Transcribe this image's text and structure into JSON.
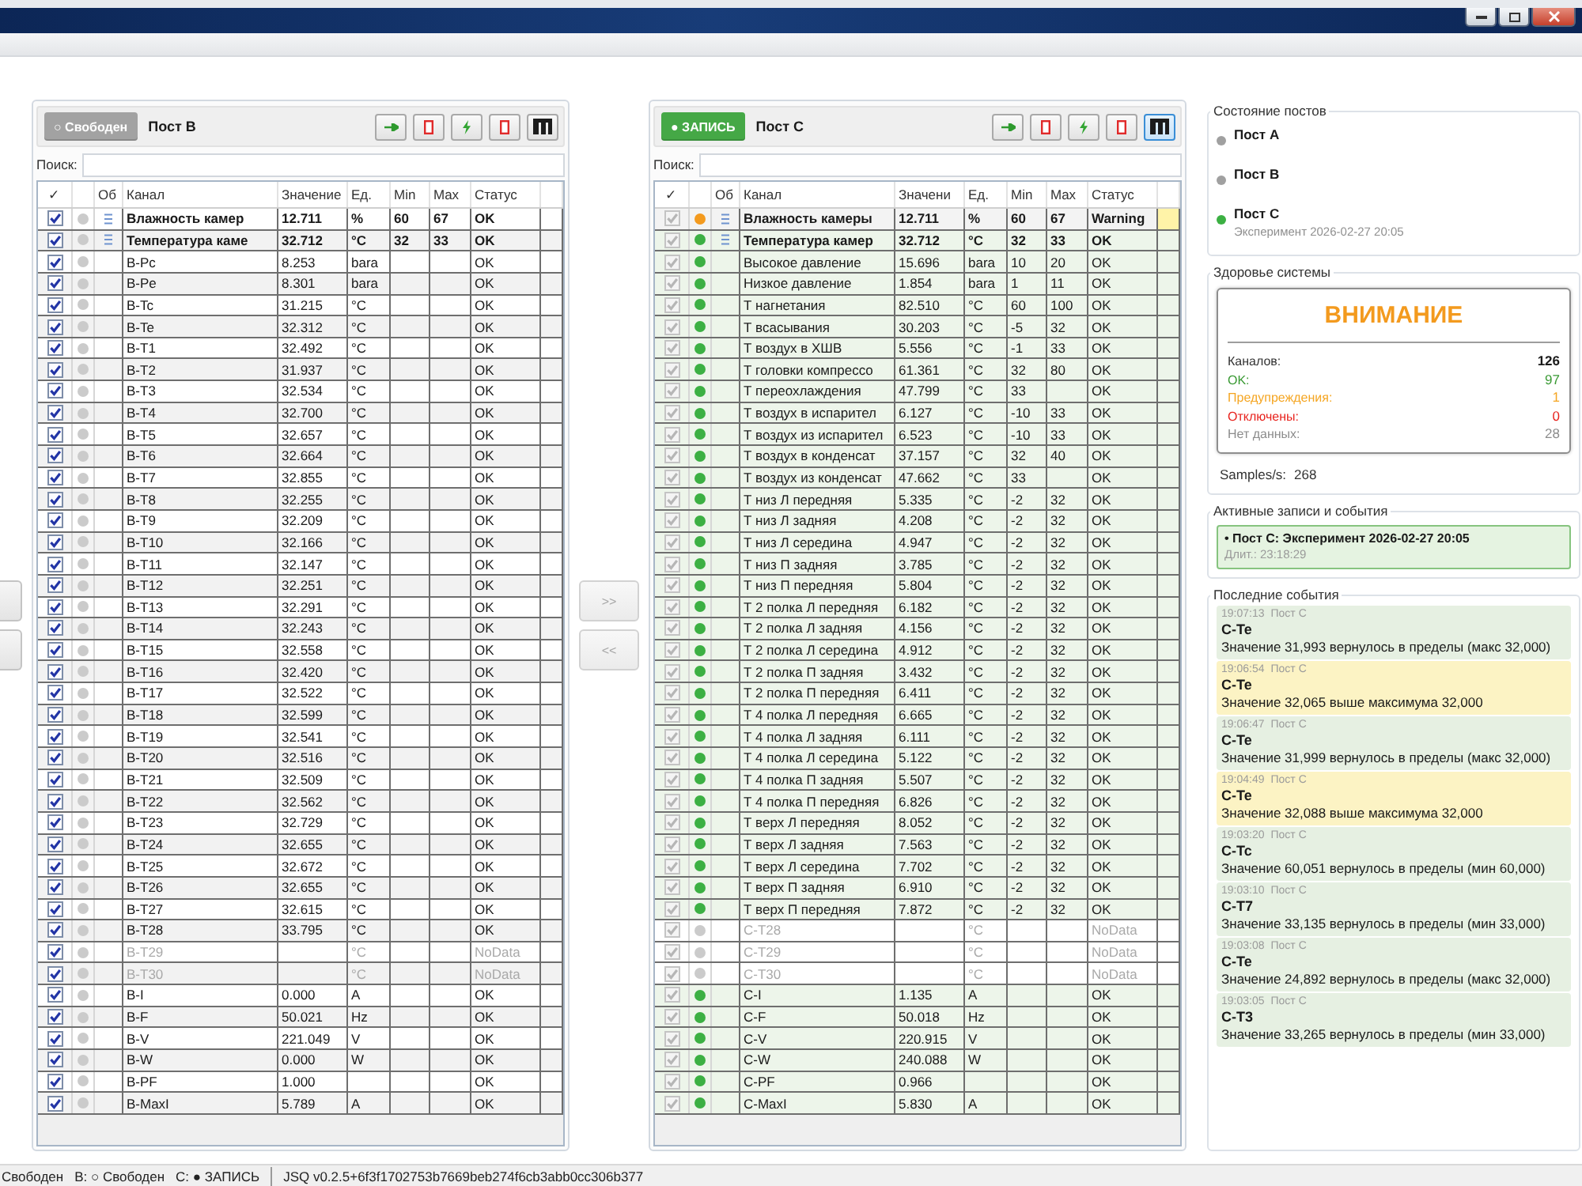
{
  "posts": [
    {
      "title": "Пост B",
      "status": {
        "kind": "free",
        "label": "○ Свободен"
      },
      "tools": [
        {
          "kind": "arrow",
          "selected": false
        },
        {
          "kind": "stop",
          "selected": false
        },
        {
          "kind": "bolt",
          "selected": false
        },
        {
          "kind": "stop",
          "selected": false
        },
        {
          "kind": "columns",
          "selected": false
        }
      ],
      "search": {
        "label": "Поиск:"
      },
      "header": {
        "check": "✓",
        "group": "Об",
        "channel": "Канал",
        "value": "Значение",
        "unit": "Ед.",
        "min": "Min",
        "max": "Max",
        "status": "Статус"
      },
      "rows": [
        {
          "kind": "group",
          "checked": true,
          "warning": false,
          "no_data": false,
          "channel": "Влажность камер",
          "value": "12.711",
          "unit": "%",
          "min": "60",
          "max": "67",
          "status": "OK"
        },
        {
          "kind": "group",
          "checked": true,
          "warning": false,
          "no_data": false,
          "channel": "Температура каме",
          "value": "32.712",
          "unit": "°C",
          "min": "32",
          "max": "33",
          "status": "OK"
        },
        {
          "kind": "sensor",
          "checked": true,
          "warning": false,
          "no_data": false,
          "channel": "B-Pc",
          "value": "8.253",
          "unit": "bara",
          "status": "OK"
        },
        {
          "kind": "sensor",
          "checked": true,
          "warning": false,
          "no_data": false,
          "channel": "B-Pe",
          "value": "8.301",
          "unit": "bara",
          "status": "OK"
        },
        {
          "kind": "sensor",
          "checked": true,
          "warning": false,
          "no_data": false,
          "channel": "B-Tc",
          "value": "31.215",
          "unit": "°C",
          "status": "OK"
        },
        {
          "kind": "sensor",
          "checked": true,
          "warning": false,
          "no_data": false,
          "channel": "B-Te",
          "value": "32.312",
          "unit": "°C",
          "status": "OK"
        },
        {
          "kind": "sensor",
          "checked": true,
          "warning": false,
          "no_data": false,
          "channel": "B-T1",
          "value": "32.492",
          "unit": "°C",
          "status": "OK"
        },
        {
          "kind": "sensor",
          "checked": true,
          "warning": false,
          "no_data": false,
          "channel": "B-T2",
          "value": "31.937",
          "unit": "°C",
          "status": "OK"
        },
        {
          "kind": "sensor",
          "checked": true,
          "warning": false,
          "no_data": false,
          "channel": "B-T3",
          "value": "32.534",
          "unit": "°C",
          "status": "OK"
        },
        {
          "kind": "sensor",
          "checked": true,
          "warning": false,
          "no_data": false,
          "channel": "B-T4",
          "value": "32.700",
          "unit": "°C",
          "status": "OK"
        },
        {
          "kind": "sensor",
          "checked": true,
          "warning": false,
          "no_data": false,
          "channel": "B-T5",
          "value": "32.657",
          "unit": "°C",
          "status": "OK"
        },
        {
          "kind": "sensor",
          "checked": true,
          "warning": false,
          "no_data": false,
          "channel": "B-T6",
          "value": "32.664",
          "unit": "°C",
          "status": "OK"
        },
        {
          "kind": "sensor",
          "checked": true,
          "warning": false,
          "no_data": false,
          "channel": "B-T7",
          "value": "32.855",
          "unit": "°C",
          "status": "OK"
        },
        {
          "kind": "sensor",
          "checked": true,
          "warning": false,
          "no_data": false,
          "channel": "B-T8",
          "value": "32.255",
          "unit": "°C",
          "status": "OK"
        },
        {
          "kind": "sensor",
          "checked": true,
          "warning": false,
          "no_data": false,
          "channel": "B-T9",
          "value": "32.209",
          "unit": "°C",
          "status": "OK"
        },
        {
          "kind": "sensor",
          "checked": true,
          "warning": false,
          "no_data": false,
          "channel": "B-T10",
          "value": "32.166",
          "unit": "°C",
          "status": "OK"
        },
        {
          "kind": "sensor",
          "checked": true,
          "warning": false,
          "no_data": false,
          "channel": "B-T11",
          "value": "32.147",
          "unit": "°C",
          "status": "OK"
        },
        {
          "kind": "sensor",
          "checked": true,
          "warning": false,
          "no_data": false,
          "channel": "B-T12",
          "value": "32.251",
          "unit": "°C",
          "status": "OK"
        },
        {
          "kind": "sensor",
          "checked": true,
          "warning": false,
          "no_data": false,
          "channel": "B-T13",
          "value": "32.291",
          "unit": "°C",
          "status": "OK"
        },
        {
          "kind": "sensor",
          "checked": true,
          "warning": false,
          "no_data": false,
          "channel": "B-T14",
          "value": "32.243",
          "unit": "°C",
          "status": "OK"
        },
        {
          "kind": "sensor",
          "checked": true,
          "warning": false,
          "no_data": false,
          "channel": "B-T15",
          "value": "32.558",
          "unit": "°C",
          "status": "OK"
        },
        {
          "kind": "sensor",
          "checked": true,
          "warning": false,
          "no_data": false,
          "channel": "B-T16",
          "value": "32.420",
          "unit": "°C",
          "status": "OK"
        },
        {
          "kind": "sensor",
          "checked": true,
          "warning": false,
          "no_data": false,
          "channel": "B-T17",
          "value": "32.522",
          "unit": "°C",
          "status": "OK"
        },
        {
          "kind": "sensor",
          "checked": true,
          "warning": false,
          "no_data": false,
          "channel": "B-T18",
          "value": "32.599",
          "unit": "°C",
          "status": "OK"
        },
        {
          "kind": "sensor",
          "checked": true,
          "warning": false,
          "no_data": false,
          "channel": "B-T19",
          "value": "32.541",
          "unit": "°C",
          "status": "OK"
        },
        {
          "kind": "sensor",
          "checked": true,
          "warning": false,
          "no_data": false,
          "channel": "B-T20",
          "value": "32.516",
          "unit": "°C",
          "status": "OK"
        },
        {
          "kind": "sensor",
          "checked": true,
          "warning": false,
          "no_data": false,
          "channel": "B-T21",
          "value": "32.509",
          "unit": "°C",
          "status": "OK"
        },
        {
          "kind": "sensor",
          "checked": true,
          "warning": false,
          "no_data": false,
          "channel": "B-T22",
          "value": "32.562",
          "unit": "°C",
          "status": "OK"
        },
        {
          "kind": "sensor",
          "checked": true,
          "warning": false,
          "no_data": false,
          "channel": "B-T23",
          "value": "32.729",
          "unit": "°C",
          "status": "OK"
        },
        {
          "kind": "sensor",
          "checked": true,
          "warning": false,
          "no_data": false,
          "channel": "B-T24",
          "value": "32.655",
          "unit": "°C",
          "status": "OK"
        },
        {
          "kind": "sensor",
          "checked": true,
          "warning": false,
          "no_data": false,
          "channel": "B-T25",
          "value": "32.672",
          "unit": "°C",
          "status": "OK"
        },
        {
          "kind": "sensor",
          "checked": true,
          "warning": false,
          "no_data": false,
          "channel": "B-T26",
          "value": "32.655",
          "unit": "°C",
          "status": "OK"
        },
        {
          "kind": "sensor",
          "checked": true,
          "warning": false,
          "no_data": false,
          "channel": "B-T27",
          "value": "32.615",
          "unit": "°C",
          "status": "OK"
        },
        {
          "kind": "sensor",
          "checked": true,
          "warning": false,
          "no_data": false,
          "channel": "B-T28",
          "value": "33.795",
          "unit": "°C",
          "status": "OK"
        },
        {
          "kind": "sensor",
          "checked": true,
          "warning": false,
          "no_data": true,
          "channel": "B-T29",
          "unit": "°C",
          "status": "NoData"
        },
        {
          "kind": "sensor",
          "checked": true,
          "warning": false,
          "no_data": true,
          "channel": "B-T30",
          "unit": "°C",
          "status": "NoData"
        },
        {
          "kind": "sensor",
          "checked": true,
          "warning": false,
          "no_data": false,
          "channel": "B-I",
          "value": "0.000",
          "unit": "A",
          "status": "OK"
        },
        {
          "kind": "sensor",
          "checked": true,
          "warning": false,
          "no_data": false,
          "channel": "B-F",
          "value": "50.021",
          "unit": "Hz",
          "status": "OK"
        },
        {
          "kind": "sensor",
          "checked": true,
          "warning": false,
          "no_data": false,
          "channel": "B-V",
          "value": "221.049",
          "unit": "V",
          "status": "OK"
        },
        {
          "kind": "sensor",
          "checked": true,
          "warning": false,
          "no_data": false,
          "channel": "B-W",
          "value": "0.000",
          "unit": "W",
          "status": "OK"
        },
        {
          "kind": "sensor",
          "checked": true,
          "warning": false,
          "no_data": false,
          "channel": "B-PF",
          "value": "1.000",
          "status": "OK"
        },
        {
          "kind": "sensor",
          "checked": true,
          "warning": false,
          "no_data": false,
          "channel": "B-MaxI",
          "value": "5.789",
          "unit": "A",
          "status": "OK"
        }
      ]
    },
    {
      "title": "Пост C",
      "status": {
        "kind": "recording",
        "label": "● ЗАПИСЬ"
      },
      "tools": [
        {
          "kind": "arrow",
          "selected": false
        },
        {
          "kind": "stop",
          "selected": false
        },
        {
          "kind": "bolt",
          "selected": false
        },
        {
          "kind": "stop",
          "selected": false
        },
        {
          "kind": "columns",
          "selected": true
        }
      ],
      "search": {
        "label": "Поиск:"
      },
      "header": {
        "check": "✓",
        "group": "Об",
        "channel": "Канал",
        "value": "Значени",
        "unit": "Ед.",
        "min": "Min",
        "max": "Max",
        "status": "Статус"
      },
      "rows": [
        {
          "kind": "group",
          "checked": true,
          "warning": true,
          "no_data": false,
          "channel": "Влажность камеры",
          "value": "12.711",
          "unit": "%",
          "min": "60",
          "max": "67",
          "status": "Warning"
        },
        {
          "kind": "group",
          "checked": true,
          "warning": false,
          "no_data": false,
          "channel": "Температура камер",
          "value": "32.712",
          "unit": "°C",
          "min": "32",
          "max": "33",
          "status": "OK"
        },
        {
          "kind": "sensor",
          "checked": true,
          "warning": false,
          "no_data": false,
          "channel": "Высокое давление",
          "value": "15.696",
          "unit": "bara",
          "min": "10",
          "max": "20",
          "status": "OK"
        },
        {
          "kind": "sensor",
          "checked": true,
          "warning": false,
          "no_data": false,
          "channel": "Низкое давление",
          "value": "1.854",
          "unit": "bara",
          "min": "1",
          "max": "11",
          "status": "OK"
        },
        {
          "kind": "sensor",
          "checked": true,
          "warning": false,
          "no_data": false,
          "channel": "Т нагнетания",
          "value": "82.510",
          "unit": "°C",
          "min": "60",
          "max": "100",
          "status": "OK"
        },
        {
          "kind": "sensor",
          "checked": true,
          "warning": false,
          "no_data": false,
          "channel": "Т всасывания",
          "value": "30.203",
          "unit": "°C",
          "min": "-5",
          "max": "32",
          "status": "OK"
        },
        {
          "kind": "sensor",
          "checked": true,
          "warning": false,
          "no_data": false,
          "channel": "Т воздух в ХШВ",
          "value": "5.556",
          "unit": "°C",
          "min": "-1",
          "max": "33",
          "status": "OK"
        },
        {
          "kind": "sensor",
          "checked": true,
          "warning": false,
          "no_data": false,
          "channel": "Т головки компрессо",
          "value": "61.361",
          "unit": "°C",
          "min": "32",
          "max": "80",
          "status": "OK"
        },
        {
          "kind": "sensor",
          "checked": true,
          "warning": false,
          "no_data": false,
          "channel": "Т переохлаждения",
          "value": "47.799",
          "unit": "°C",
          "min": "33",
          "status": "OK"
        },
        {
          "kind": "sensor",
          "checked": true,
          "warning": false,
          "no_data": false,
          "channel": "Т воздух в испарител",
          "value": "6.127",
          "unit": "°C",
          "min": "-10",
          "max": "33",
          "status": "OK"
        },
        {
          "kind": "sensor",
          "checked": true,
          "warning": false,
          "no_data": false,
          "channel": "Т воздух из испарител",
          "value": "6.523",
          "unit": "°C",
          "min": "-10",
          "max": "33",
          "status": "OK"
        },
        {
          "kind": "sensor",
          "checked": true,
          "warning": false,
          "no_data": false,
          "channel": "Т воздух в конденсат",
          "value": "37.157",
          "unit": "°C",
          "min": "32",
          "max": "40",
          "status": "OK"
        },
        {
          "kind": "sensor",
          "checked": true,
          "warning": false,
          "no_data": false,
          "channel": "Т воздух из конденсат",
          "value": "47.662",
          "unit": "°C",
          "min": "33",
          "status": "OK"
        },
        {
          "kind": "sensor",
          "checked": true,
          "warning": false,
          "no_data": false,
          "channel": "Т низ Л передняя",
          "value": "5.335",
          "unit": "°C",
          "min": "-2",
          "max": "32",
          "status": "OK"
        },
        {
          "kind": "sensor",
          "checked": true,
          "warning": false,
          "no_data": false,
          "channel": "Т низ Л задняя",
          "value": "4.208",
          "unit": "°C",
          "min": "-2",
          "max": "32",
          "status": "OK"
        },
        {
          "kind": "sensor",
          "checked": true,
          "warning": false,
          "no_data": false,
          "channel": "Т низ Л середина",
          "value": "4.947",
          "unit": "°C",
          "min": "-2",
          "max": "32",
          "status": "OK"
        },
        {
          "kind": "sensor",
          "checked": true,
          "warning": false,
          "no_data": false,
          "channel": "Т низ П задняя",
          "value": "3.785",
          "unit": "°C",
          "min": "-2",
          "max": "32",
          "status": "OK"
        },
        {
          "kind": "sensor",
          "checked": true,
          "warning": false,
          "no_data": false,
          "channel": "Т низ П передняя",
          "value": "5.804",
          "unit": "°C",
          "min": "-2",
          "max": "32",
          "status": "OK"
        },
        {
          "kind": "sensor",
          "checked": true,
          "warning": false,
          "no_data": false,
          "channel": "Т 2 полка Л передняя",
          "value": "6.182",
          "unit": "°C",
          "min": "-2",
          "max": "32",
          "status": "OK"
        },
        {
          "kind": "sensor",
          "checked": true,
          "warning": false,
          "no_data": false,
          "channel": "Т 2 полка Л задняя",
          "value": "4.156",
          "unit": "°C",
          "min": "-2",
          "max": "32",
          "status": "OK"
        },
        {
          "kind": "sensor",
          "checked": true,
          "warning": false,
          "no_data": false,
          "channel": "Т 2 полка Л середина",
          "value": "4.912",
          "unit": "°C",
          "min": "-2",
          "max": "32",
          "status": "OK"
        },
        {
          "kind": "sensor",
          "checked": true,
          "warning": false,
          "no_data": false,
          "channel": "Т 2 полка П задняя",
          "value": "3.432",
          "unit": "°C",
          "min": "-2",
          "max": "32",
          "status": "OK"
        },
        {
          "kind": "sensor",
          "checked": true,
          "warning": false,
          "no_data": false,
          "channel": "Т 2 полка П передняя",
          "value": "6.411",
          "unit": "°C",
          "min": "-2",
          "max": "32",
          "status": "OK"
        },
        {
          "kind": "sensor",
          "checked": true,
          "warning": false,
          "no_data": false,
          "channel": "Т 4 полка Л передняя",
          "value": "6.665",
          "unit": "°C",
          "min": "-2",
          "max": "32",
          "status": "OK"
        },
        {
          "kind": "sensor",
          "checked": true,
          "warning": false,
          "no_data": false,
          "channel": "Т 4 полка Л задняя",
          "value": "6.111",
          "unit": "°C",
          "min": "-2",
          "max": "32",
          "status": "OK"
        },
        {
          "kind": "sensor",
          "checked": true,
          "warning": false,
          "no_data": false,
          "channel": "Т 4 полка Л середина",
          "value": "5.122",
          "unit": "°C",
          "min": "-2",
          "max": "32",
          "status": "OK"
        },
        {
          "kind": "sensor",
          "checked": true,
          "warning": false,
          "no_data": false,
          "channel": "Т 4 полка П задняя",
          "value": "5.507",
          "unit": "°C",
          "min": "-2",
          "max": "32",
          "status": "OK"
        },
        {
          "kind": "sensor",
          "checked": true,
          "warning": false,
          "no_data": false,
          "channel": "Т 4 полка П передняя",
          "value": "6.826",
          "unit": "°C",
          "min": "-2",
          "max": "32",
          "status": "OK"
        },
        {
          "kind": "sensor",
          "checked": true,
          "warning": false,
          "no_data": false,
          "channel": "Т верх Л передняя",
          "value": "8.052",
          "unit": "°C",
          "min": "-2",
          "max": "32",
          "status": "OK"
        },
        {
          "kind": "sensor",
          "checked": true,
          "warning": false,
          "no_data": false,
          "channel": "Т верх Л задняя",
          "value": "7.563",
          "unit": "°C",
          "min": "-2",
          "max": "32",
          "status": "OK"
        },
        {
          "kind": "sensor",
          "checked": true,
          "warning": false,
          "no_data": false,
          "channel": "Т верх Л середина",
          "value": "7.702",
          "unit": "°C",
          "min": "-2",
          "max": "32",
          "status": "OK"
        },
        {
          "kind": "sensor",
          "checked": true,
          "warning": false,
          "no_data": false,
          "channel": "Т верх П задняя",
          "value": "6.910",
          "unit": "°C",
          "min": "-2",
          "max": "32",
          "status": "OK"
        },
        {
          "kind": "sensor",
          "checked": true,
          "warning": false,
          "no_data": false,
          "channel": "Т верх П передняя",
          "value": "7.872",
          "unit": "°C",
          "min": "-2",
          "max": "32",
          "status": "OK"
        },
        {
          "kind": "sensor",
          "checked": true,
          "warning": false,
          "no_data": true,
          "channel": "C-T28",
          "unit": "°C",
          "status": "NoData"
        },
        {
          "kind": "sensor",
          "checked": true,
          "warning": false,
          "no_data": true,
          "channel": "C-T29",
          "unit": "°C",
          "status": "NoData"
        },
        {
          "kind": "sensor",
          "checked": true,
          "warning": false,
          "no_data": true,
          "channel": "C-T30",
          "unit": "°C",
          "status": "NoData"
        },
        {
          "kind": "sensor",
          "checked": true,
          "warning": false,
          "no_data": false,
          "channel": "C-I",
          "value": "1.135",
          "unit": "A",
          "status": "OK"
        },
        {
          "kind": "sensor",
          "checked": true,
          "warning": false,
          "no_data": false,
          "channel": "C-F",
          "value": "50.018",
          "unit": "Hz",
          "status": "OK"
        },
        {
          "kind": "sensor",
          "checked": true,
          "warning": false,
          "no_data": false,
          "channel": "C-V",
          "value": "220.915",
          "unit": "V",
          "status": "OK"
        },
        {
          "kind": "sensor",
          "checked": true,
          "warning": false,
          "no_data": false,
          "channel": "C-W",
          "value": "240.088",
          "unit": "W",
          "status": "OK"
        },
        {
          "kind": "sensor",
          "checked": true,
          "warning": false,
          "no_data": false,
          "channel": "C-PF",
          "value": "0.966",
          "status": "OK"
        },
        {
          "kind": "sensor",
          "checked": true,
          "warning": false,
          "no_data": false,
          "channel": "C-MaxI",
          "value": "5.830",
          "unit": "A",
          "status": "OK"
        }
      ]
    }
  ],
  "transfer_buttons": [
    {
      "label": ">>",
      "disabled": true
    },
    {
      "label": "<<",
      "disabled": true
    }
  ],
  "post_states": {
    "title": "Состояние постов",
    "items": [
      {
        "name": "Пост A",
        "color": "#a0a0a0"
      },
      {
        "name": "Пост B",
        "color": "#a0a0a0"
      },
      {
        "name": "Пост C",
        "color": "#3cb043",
        "detail": "Эксперимент 2026-02-27 20:05"
      }
    ]
  },
  "system_health": {
    "title": "Здоровье системы",
    "warning": true,
    "banner": "ВНИМАНИЕ",
    "stats": [
      {
        "label": "Каналов:",
        "value": "126",
        "color": "#1a1a1a"
      },
      {
        "label": "OK:",
        "value": "97",
        "color": "#3a9a34"
      },
      {
        "label": "Предупреждения:",
        "value": "1",
        "color": "#f5a623"
      },
      {
        "label": "Отключены:",
        "value": "0",
        "color": "#e8231e"
      },
      {
        "label": "Нет данных:",
        "value": "28",
        "color": "#8c8c8c"
      }
    ],
    "samples_label": "Samples/s:",
    "samples_value": "268"
  },
  "active_records": {
    "title": "Активные записи и события",
    "items": [
      {
        "text": "• Пост C: Эксперимент 2026-02-27 20:05",
        "duration": "Длит.: 23:18:29"
      }
    ]
  },
  "recent_events": {
    "title": "Последние события",
    "items": [
      {
        "kind": "normal",
        "time": "19:07:13",
        "post": "Пост C",
        "channel": "C-Te",
        "message": "Значение 31,993 вернулось в пределы (макс 32,000)"
      },
      {
        "kind": "warning",
        "time": "19:06:54",
        "post": "Пост C",
        "channel": "C-Te",
        "message": "Значение 32,065 выше максимума 32,000"
      },
      {
        "kind": "normal",
        "time": "19:06:47",
        "post": "Пост C",
        "channel": "C-Te",
        "message": "Значение 31,999 вернулось в пределы (макс 32,000)"
      },
      {
        "kind": "warning",
        "time": "19:04:49",
        "post": "Пост C",
        "channel": "C-Te",
        "message": "Значение 32,088 выше максимума 32,000"
      },
      {
        "kind": "normal",
        "time": "19:03:20",
        "post": "Пост C",
        "channel": "C-Tc",
        "message": "Значение 60,051 вернулось в пределы (мин 60,000)"
      },
      {
        "kind": "normal",
        "time": "19:03:10",
        "post": "Пост C",
        "channel": "C-T7",
        "message": "Значение 33,135 вернулось в пределы (мин 33,000)"
      },
      {
        "kind": "normal",
        "time": "19:03:08",
        "post": "Пост C",
        "channel": "C-Te",
        "message": "Значение 24,892 вернулось в пределы (макс 32,000)"
      },
      {
        "kind": "normal",
        "time": "19:03:05",
        "post": "Пост C",
        "channel": "C-T3",
        "message": "Значение 33,265 вернулось в пределы (мин 33,000)"
      }
    ]
  },
  "status_bar": {
    "items": [
      "Свободен",
      "B: ○ Свободен",
      "C: ● ЗАПИСЬ"
    ],
    "version": "JSQ v0.2.5+6f3f1702753b7669beb274f6cb3abb0cc306b377"
  }
}
